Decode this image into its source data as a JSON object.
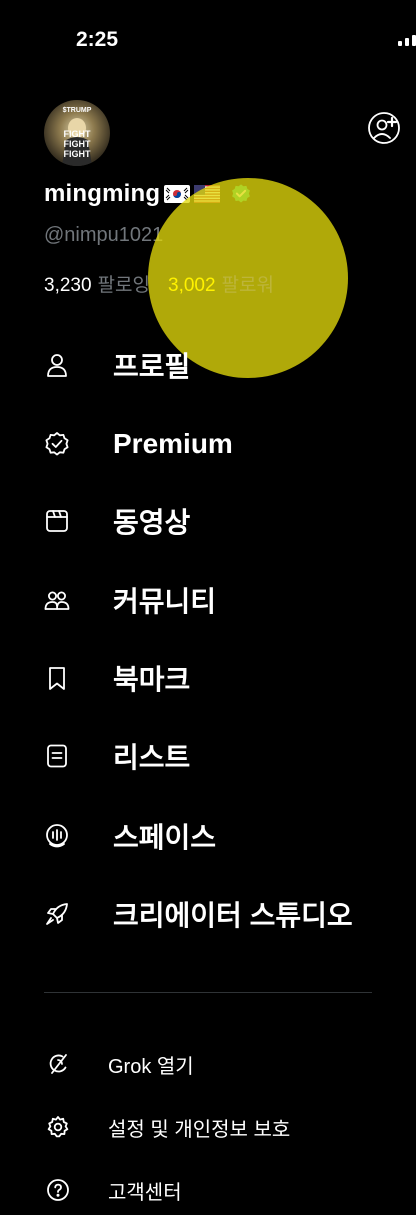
{
  "status_bar": {
    "time": "2:25"
  },
  "profile": {
    "display_name": "mingming",
    "flags": [
      "korea-flag",
      "usa-flag"
    ],
    "handle": "@nimpu1021",
    "following_count": "3,230",
    "following_label": "팔로잉",
    "followers_count": "3,002",
    "followers_label": "팔로워",
    "avatar_text": [
      "$TRUMP",
      "FIGHT",
      "FIGHT",
      "FIGHT"
    ]
  },
  "menu": {
    "items": [
      {
        "label": "프로필",
        "icon": "person-icon"
      },
      {
        "label": "Premium",
        "icon": "verified-badge-icon"
      },
      {
        "label": "동영상",
        "icon": "video-icon"
      },
      {
        "label": "커뮤니티",
        "icon": "communities-icon"
      },
      {
        "label": "북마크",
        "icon": "bookmark-icon"
      },
      {
        "label": "리스트",
        "icon": "list-icon"
      },
      {
        "label": "스페이스",
        "icon": "spaces-icon"
      },
      {
        "label": "크리에이터 스튜디오",
        "icon": "rocket-icon"
      }
    ]
  },
  "secondary": {
    "items": [
      {
        "label": "Grok 열기",
        "icon": "grok-icon"
      },
      {
        "label": "설정 및 개인정보 보호",
        "icon": "gear-icon"
      },
      {
        "label": "고객센터",
        "icon": "help-icon"
      }
    ]
  },
  "colors": {
    "background": "#000000",
    "text": "#ffffff",
    "muted": "#71767b",
    "verified": "#00ba7c",
    "highlight": "#e2d90c"
  }
}
